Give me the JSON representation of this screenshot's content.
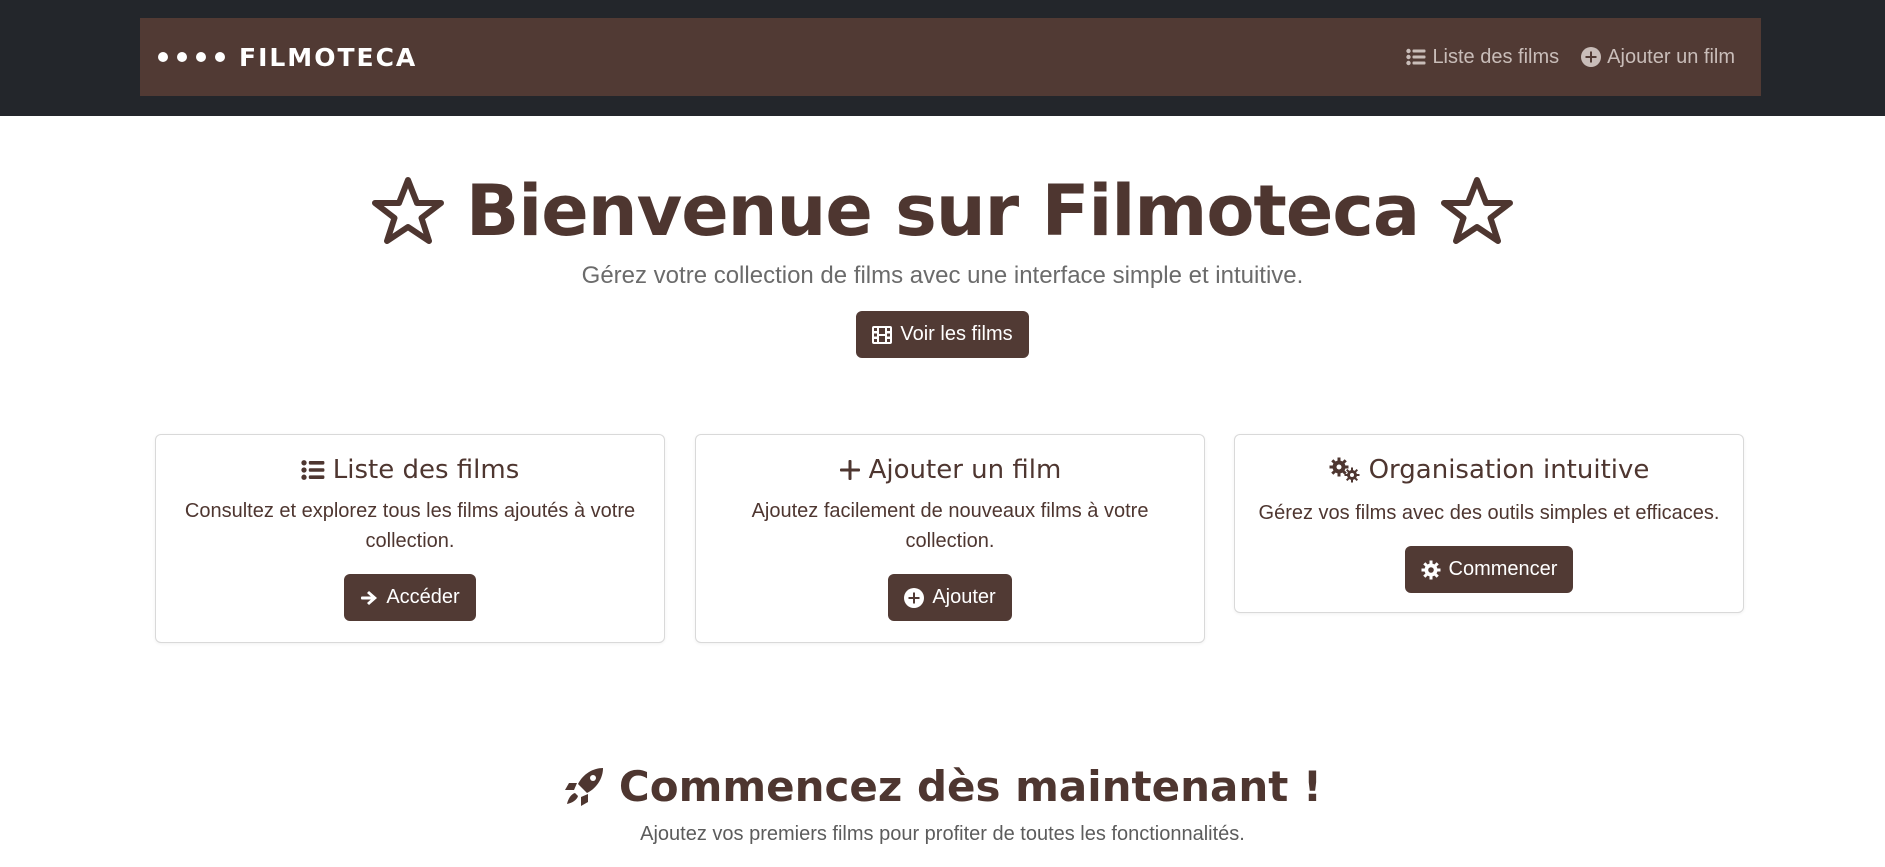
{
  "brand": {
    "name": "FILMOTECA",
    "logo_icon": "four-dots-icon"
  },
  "nav": {
    "items": [
      {
        "label": "Liste des films",
        "icon": "list-icon"
      },
      {
        "label": "Ajouter un film",
        "icon": "plus-circle-icon"
      }
    ]
  },
  "hero": {
    "title": "Bienvenue sur Filmoteca",
    "subtitle": "Gérez votre collection de films avec une interface simple et intuitive.",
    "button_label": "Voir les films",
    "button_icon": "film-icon",
    "title_icon": "star-outline-icon"
  },
  "cards": [
    {
      "title": "Liste des films",
      "icon": "list-icon",
      "text": "Consultez et explorez tous les films ajoutés à votre collection.",
      "button_label": "Accéder",
      "button_icon": "arrow-right-icon"
    },
    {
      "title": "Ajouter un film",
      "icon": "plus-icon",
      "text": "Ajoutez facilement de nouveaux films à votre collection.",
      "button_label": "Ajouter",
      "button_icon": "plus-circle-icon"
    },
    {
      "title": "Organisation intuitive",
      "icon": "gears-icon",
      "text": "Gérez vos films avec des outils simples et efficaces.",
      "button_label": "Commencer",
      "button_icon": "gear-icon"
    }
  ],
  "cta": {
    "title": "Commencez dès maintenant !",
    "subtitle": "Ajoutez vos premiers films pour profiter de toutes les fonctionnalités.",
    "icon": "rocket-icon"
  },
  "colors": {
    "brand": "#513a34",
    "topbar": "#23262b",
    "text": "#4e3630"
  }
}
